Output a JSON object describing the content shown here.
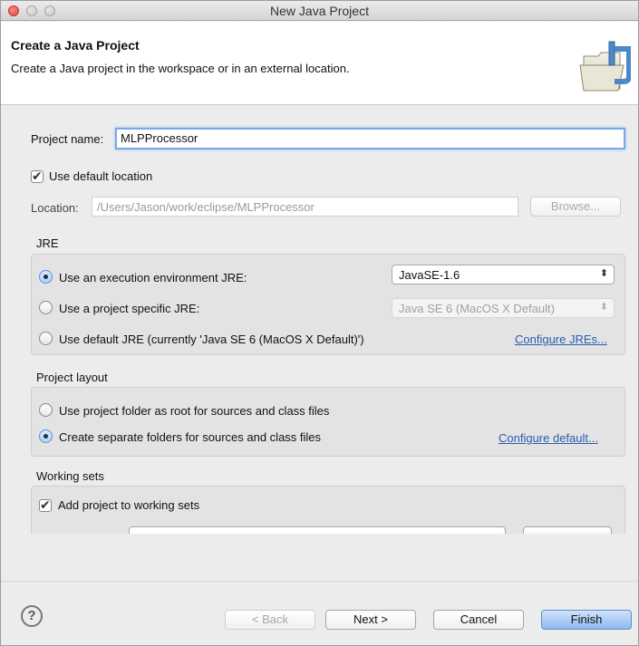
{
  "window": {
    "title": "New Java Project"
  },
  "header": {
    "heading": "Create a Java Project",
    "description": "Create a Java project in the workspace or in an external location."
  },
  "project": {
    "name_label": "Project name:",
    "name_value": "MLPProcessor",
    "use_default_location_label": "Use default location",
    "use_default_location_checked": true,
    "location_label": "Location:",
    "location_value": "/Users/Jason/work/eclipse/MLPProcessor",
    "browse_label": "Browse..."
  },
  "jre": {
    "section_title": "JRE",
    "options": [
      {
        "label": "Use an execution environment JRE:",
        "selected": true
      },
      {
        "label": "Use a project specific JRE:",
        "selected": false
      },
      {
        "label": "Use default JRE (currently 'Java SE 6 (MacOS X Default)')",
        "selected": false
      }
    ],
    "execution_env_value": "JavaSE-1.6",
    "project_specific_value": "Java SE 6 (MacOS X Default)",
    "configure_link": "Configure JREs..."
  },
  "layout": {
    "section_title": "Project layout",
    "options": [
      {
        "label": "Use project folder as root for sources and class files",
        "selected": false
      },
      {
        "label": "Create separate folders for sources and class files",
        "selected": true
      }
    ],
    "configure_link": "Configure default..."
  },
  "working_sets": {
    "section_title": "Working sets",
    "add_label": "Add project to working sets",
    "add_checked": true
  },
  "footer": {
    "help_icon": "?",
    "back_label": "< Back",
    "next_label": "Next >",
    "cancel_label": "Cancel",
    "finish_label": "Finish"
  },
  "icons": {
    "banner": "java-project-folder-icon",
    "help": "help-icon"
  }
}
